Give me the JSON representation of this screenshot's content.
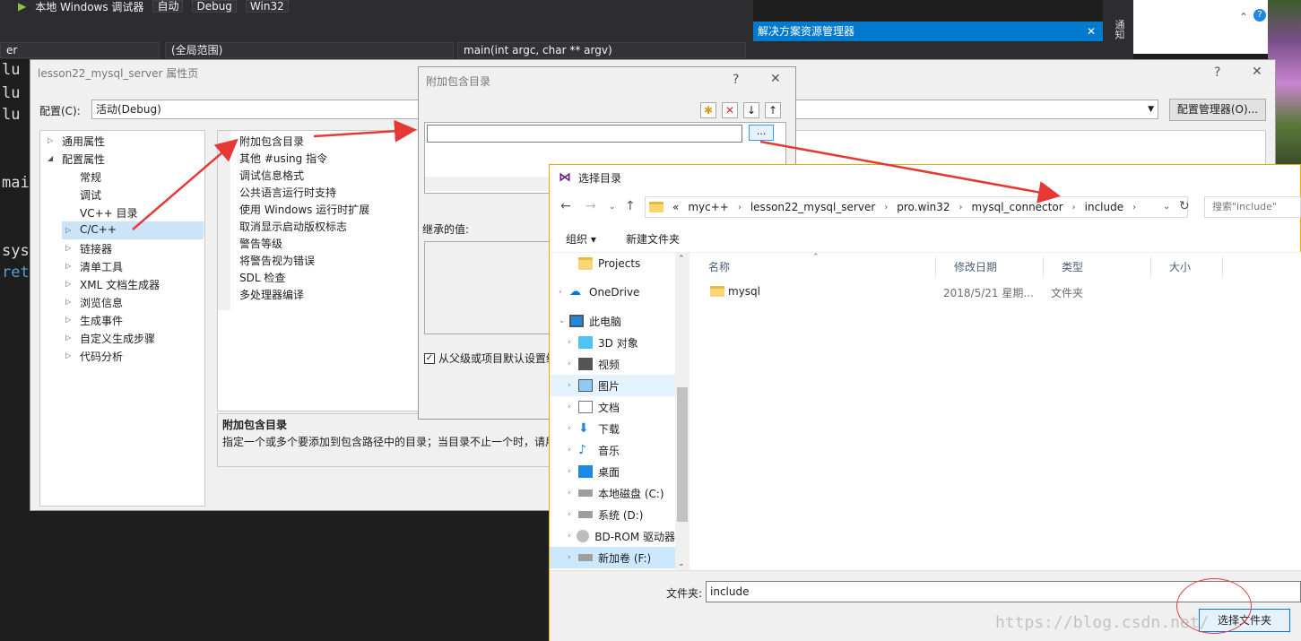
{
  "vs": {
    "toolbar": {
      "run_label": "本地 Windows 调试器",
      "config1": "自动",
      "config2": "Debug",
      "platform": "Win32"
    },
    "nav": {
      "project": "er",
      "scope": "(全局范围)",
      "function": "main(int argc, char ** argv)"
    },
    "code_lines": [
      "lu",
      "lu",
      "lu",
      "mai",
      "sys",
      "ret"
    ],
    "solution_explorer_title": "解决方案资源管理器",
    "side_tab": "通知"
  },
  "prop_dialog": {
    "title": "lesson22_mysql_server 属性页",
    "help": "?",
    "close": "✕",
    "config_label": "配置(C):",
    "config_value": "活动(Debug)",
    "config_manager": "配置管理器(O)...",
    "tree": [
      {
        "label": "通用属性"
      },
      {
        "label": "配置属性"
      },
      {
        "label": "常规"
      },
      {
        "label": "调试"
      },
      {
        "label": "VC++ 目录"
      },
      {
        "label": "C/C++"
      },
      {
        "label": "链接器"
      },
      {
        "label": "清单工具"
      },
      {
        "label": "XML 文档生成器"
      },
      {
        "label": "浏览信息"
      },
      {
        "label": "生成事件"
      },
      {
        "label": "自定义生成步骤"
      },
      {
        "label": "代码分析"
      }
    ],
    "props": [
      "附加包含目录",
      "其他 #using 指令",
      "调试信息格式",
      "公共语言运行时支持",
      "使用 Windows 运行时扩展",
      "取消显示启动版权标志",
      "警告等级",
      "将警告视为错误",
      "SDL 检查",
      "多处理器编译"
    ],
    "desc_title": "附加包含目录",
    "desc_text": "指定一个或多个要添加到包含路径中的目录；当目录不止一个时，请用"
  },
  "inc_dialog": {
    "title": "附加包含目录",
    "help": "?",
    "close": "✕",
    "browse": "...",
    "inherit_label": "继承的值:",
    "inherit_check": "从父级或项目默认设置继承"
  },
  "folder_dialog": {
    "title": "选择目录",
    "breadcrumb": [
      "«",
      "myc++",
      "lesson22_mysql_server",
      "pro.win32",
      "mysql_connector",
      "include"
    ],
    "search_placeholder": "搜索\"include\"",
    "organize": "组织 ▾",
    "new_folder": "新建文件夹",
    "nav_items": [
      {
        "label": "Projects",
        "icon": "folder-icon"
      },
      {
        "label": "OneDrive",
        "icon": "cloud-icon"
      },
      {
        "label": "此电脑",
        "icon": "computer-icon"
      },
      {
        "label": "3D 对象",
        "icon": "cube-icon"
      },
      {
        "label": "视频",
        "icon": "video-icon"
      },
      {
        "label": "图片",
        "icon": "picture-icon"
      },
      {
        "label": "文档",
        "icon": "document-icon"
      },
      {
        "label": "下载",
        "icon": "download-icon"
      },
      {
        "label": "音乐",
        "icon": "music-icon"
      },
      {
        "label": "桌面",
        "icon": "desktop-icon"
      },
      {
        "label": "本地磁盘 (C:)",
        "icon": "drive-icon"
      },
      {
        "label": "系统 (D:)",
        "icon": "drive-icon"
      },
      {
        "label": "BD-ROM 驱动器",
        "icon": "disc-icon"
      },
      {
        "label": "新加卷 (F:)",
        "icon": "drive-icon"
      }
    ],
    "columns": [
      "名称",
      "修改日期",
      "类型",
      "大小"
    ],
    "files": [
      {
        "name": "mysql",
        "date": "2018/5/21 星期...",
        "type": "文件夹",
        "size": ""
      }
    ],
    "folder_label": "文件夹:",
    "folder_value": "include",
    "select_button": "选择文件夹"
  },
  "watermark": "https://blog.csdn.net/",
  "colors": {
    "accent": "#007acc",
    "arrow": "#e53935",
    "selection": "#cce8ff"
  }
}
